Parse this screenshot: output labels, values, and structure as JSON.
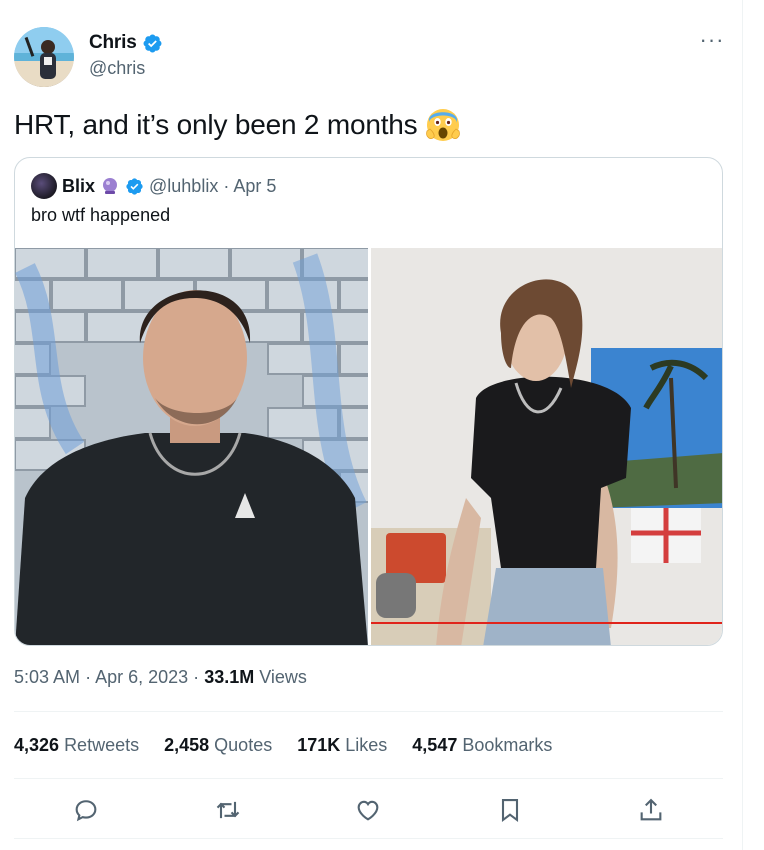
{
  "author": {
    "display_name": "Chris",
    "handle": "@chris",
    "verified": true
  },
  "tweet": {
    "text": "HRT, and it’s only been 2 months",
    "emoji": "screaming-face-emoji"
  },
  "quoted": {
    "display_name": "Blix",
    "handle": "@luhblix",
    "date": "· Apr 5",
    "text": "bro wtf happened",
    "verified": true
  },
  "meta": {
    "time": "5:03 AM",
    "date": "Apr 6, 2023",
    "views_count": "33.1M",
    "views_label": "Views",
    "sep": "·"
  },
  "stats": [
    {
      "count": "4,326",
      "label": "Retweets"
    },
    {
      "count": "2,458",
      "label": "Quotes"
    },
    {
      "count": "171K",
      "label": "Likes"
    },
    {
      "count": "4,547",
      "label": "Bookmarks"
    }
  ],
  "actions": [
    "reply-icon",
    "retweet-icon",
    "like-icon",
    "bookmark-icon",
    "share-icon"
  ],
  "colors": {
    "verified": "#1d9bf0",
    "text": "#0f1419",
    "muted": "#536471",
    "border": "#cfd9de",
    "divider": "#eff3f4"
  }
}
